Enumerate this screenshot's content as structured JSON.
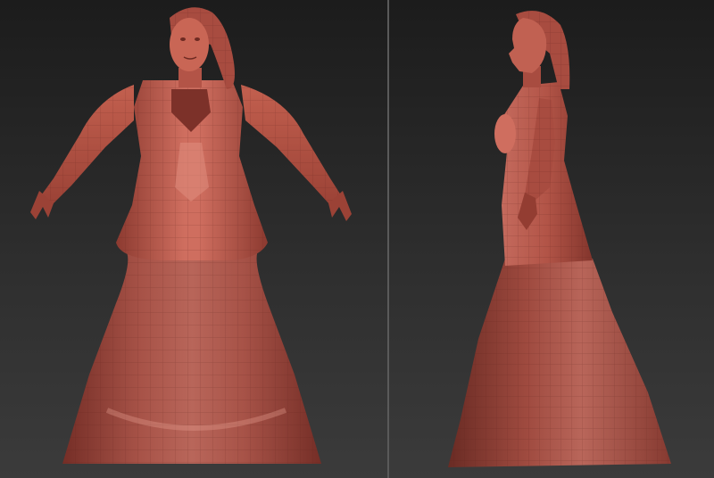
{
  "viewport": {
    "background_top": "#1c1c1c",
    "background_bottom": "#3b3b3b",
    "divider_color": "#5a5a5a"
  },
  "model": {
    "material_color": "#b85648",
    "shadow_color": "#6e2a22",
    "highlight_color": "#e08f80"
  },
  "views": [
    {
      "view": "front"
    },
    {
      "view": "side"
    }
  ]
}
